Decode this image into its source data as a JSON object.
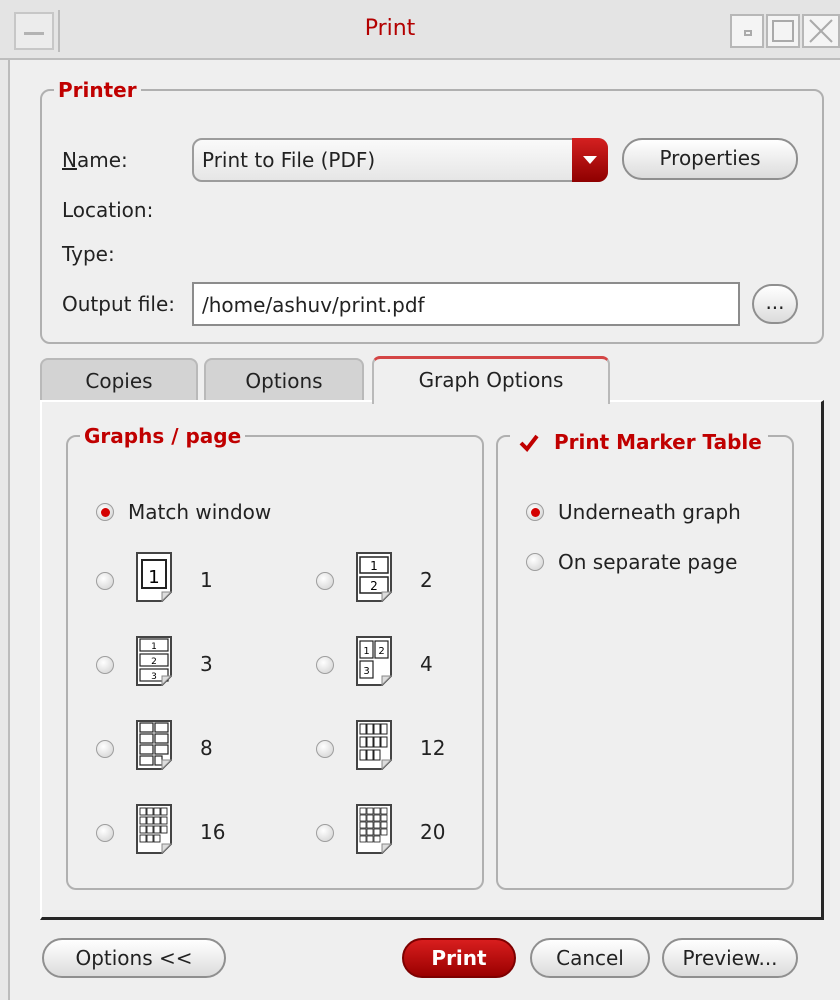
{
  "window": {
    "title": "Print",
    "controls": [
      "minimize-icon",
      "maximize-icon",
      "close-icon"
    ]
  },
  "printer": {
    "group_label": "Printer",
    "name_label": "Name:",
    "name_value": "Print to File (PDF)",
    "properties_button": "Properties",
    "location_label": "Location:",
    "type_label": "Type:",
    "output_file_label": "Output file:",
    "output_file_value": "/home/ashuv/print.pdf",
    "browse_button": "..."
  },
  "tabs": [
    {
      "label": "Copies",
      "active": false
    },
    {
      "label": "Options",
      "active": false
    },
    {
      "label": "Graph Options",
      "active": true
    }
  ],
  "graphs_per_page": {
    "group_label": "Graphs / page",
    "match_window_label": "Match window",
    "selected": "Match window",
    "options": [
      "1",
      "2",
      "3",
      "4",
      "8",
      "12",
      "16",
      "20"
    ]
  },
  "marker_table": {
    "checkbox_label": "Print Marker Table",
    "checked": true,
    "underneath_label": "Underneath graph",
    "separate_page_label": "On separate page",
    "selected": "Underneath graph"
  },
  "footer": {
    "options_button": "Options <<",
    "print_button": "Print",
    "cancel_button": "Cancel",
    "preview_button": "Preview..."
  },
  "colors": {
    "accent": "#c00000",
    "background": "#efefef"
  }
}
